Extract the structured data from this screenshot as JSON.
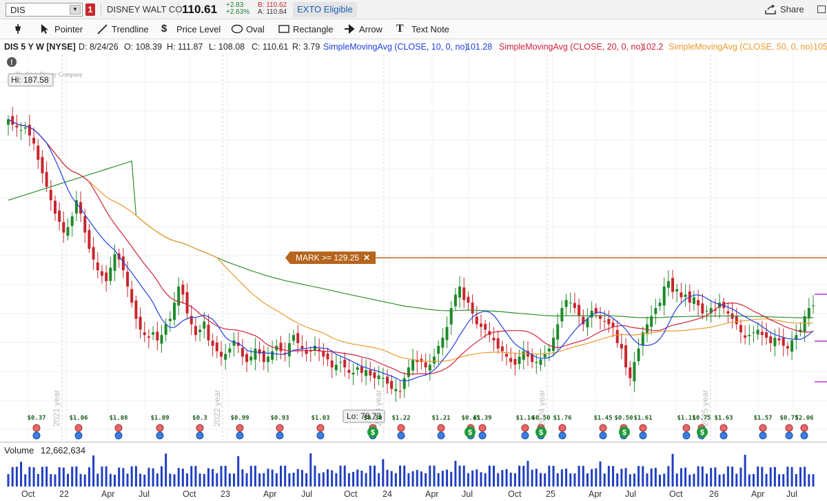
{
  "header": {
    "symbol": "DIS",
    "alert_count": "1",
    "company": "DISNEY WALT CO",
    "last": "110.61",
    "change": "+2.83",
    "change_pct": "+2.63%",
    "bid": "B: 110.62",
    "ask": "A: 110.84",
    "exto": "EXTO Eligible",
    "share_label": "Share"
  },
  "toolbar": {
    "pointer": "Pointer",
    "trendline": "Trendline",
    "price_level": "Price Level",
    "oval": "Oval",
    "rectangle": "Rectangle",
    "arrow": "Arrow",
    "text_note": "Text Note"
  },
  "studies": {
    "title": "DIS 5 Y W [NYSE]",
    "date": "D: 8/24/26",
    "open": "O: 108.39",
    "high": "H: 111.87",
    "low": "L: 108.08",
    "close": "C: 110.61",
    "range": "R: 3.79",
    "sma10": "SimpleMovingAvg (CLOSE, 10, 0, no)",
    "sma10_val": "101.28",
    "sma20": "SimpleMovingAvg (CLOSE, 20, 0, no)",
    "sma20_val": "102.2",
    "sma50": "SimpleMovingAvg (CLOSE, 50, 0, no)",
    "sma50_val": "105"
  },
  "chart": {
    "watermark": "The Walt Disney Company",
    "hi_label": "Hi: 187.58",
    "lo_label": "Lo: 78.73",
    "mark_label": "MARK >= 129.25",
    "year_labels": [
      "2021 year",
      "2022 year",
      "2023 year",
      "2024 year",
      "2025 year"
    ],
    "dividends": [
      "$0.37",
      "$1.06",
      "$1.08",
      "$1.09",
      "$0.3",
      "$0.99",
      "$0.93",
      "$1.03",
      "$0.30",
      "$1.22",
      "$1.21",
      "$0.45",
      "$1.39",
      "$1.14",
      "$0.50",
      "$1.76",
      "$1.45",
      "$0.50",
      "$1.61",
      "$1.11",
      "$0.75",
      "$1.63",
      "$1.57",
      "$0.75",
      "$2.06"
    ]
  },
  "chart_data": {
    "type": "candlestick",
    "symbol": "DIS",
    "interval": "weekly",
    "span": "5 Y",
    "high": 187.58,
    "low": 78.73,
    "last": {
      "open": 108.39,
      "high": 111.87,
      "low": 108.08,
      "close": 110.61
    },
    "price_level": 129.25,
    "x_tick_labels": [
      "Oct",
      "22",
      "Apr",
      "Jul",
      "Oct",
      "23",
      "Apr",
      "Jul",
      "Oct",
      "24",
      "Apr",
      "Jul",
      "Oct",
      "25",
      "Apr",
      "Jul",
      "Oct",
      "26",
      "Apr",
      "Jul"
    ],
    "closes_weekly_approx": [
      180,
      178,
      177,
      176,
      177,
      174,
      171,
      165,
      160,
      155,
      150,
      145,
      142,
      138,
      140,
      144,
      150,
      145,
      138,
      132,
      128,
      124,
      122,
      120,
      125,
      130,
      128,
      124,
      118,
      112,
      106,
      102,
      100,
      99,
      101,
      98,
      100,
      104,
      106,
      112,
      118,
      115,
      108,
      104,
      100,
      102,
      105,
      98,
      96,
      94,
      92,
      93,
      95,
      98,
      96,
      92,
      90,
      92,
      95,
      93,
      90,
      92,
      94,
      96,
      94,
      93,
      97,
      100,
      97,
      95,
      93,
      94,
      96,
      94,
      92,
      91,
      88,
      89,
      90,
      88,
      86,
      86,
      88,
      86,
      87,
      85,
      84,
      85,
      84,
      82,
      80,
      80,
      79,
      84,
      88,
      91,
      90,
      90,
      88,
      89,
      92,
      96,
      99,
      103,
      110,
      115,
      118,
      113,
      112,
      108,
      104,
      103,
      102,
      100,
      98,
      95,
      94,
      92,
      90,
      89,
      92,
      94,
      92,
      90,
      90,
      91,
      93,
      95,
      99,
      104,
      110,
      113,
      112,
      110,
      107,
      104,
      106,
      109,
      108,
      106,
      105,
      104,
      103,
      97,
      95,
      88,
      84,
      90,
      95,
      101,
      104,
      107,
      110,
      112,
      118,
      120,
      116,
      117,
      114,
      115,
      112,
      114,
      111,
      108,
      109,
      110,
      109,
      112,
      110,
      108,
      106,
      104,
      101,
      99,
      100,
      101,
      102,
      100,
      99,
      97,
      99,
      98,
      96,
      95,
      98,
      100,
      102,
      107,
      110,
      111
    ]
  },
  "volume": {
    "label": "Volume",
    "value": "12,662,634"
  },
  "x_labels": [
    "Oct",
    "22",
    "Apr",
    "Jul",
    "Oct",
    "23",
    "Apr",
    "Jul",
    "Oct",
    "24",
    "Apr",
    "Jul",
    "Oct",
    "25",
    "Apr",
    "Jul",
    "Oct",
    "26",
    "Apr",
    "Jul"
  ]
}
